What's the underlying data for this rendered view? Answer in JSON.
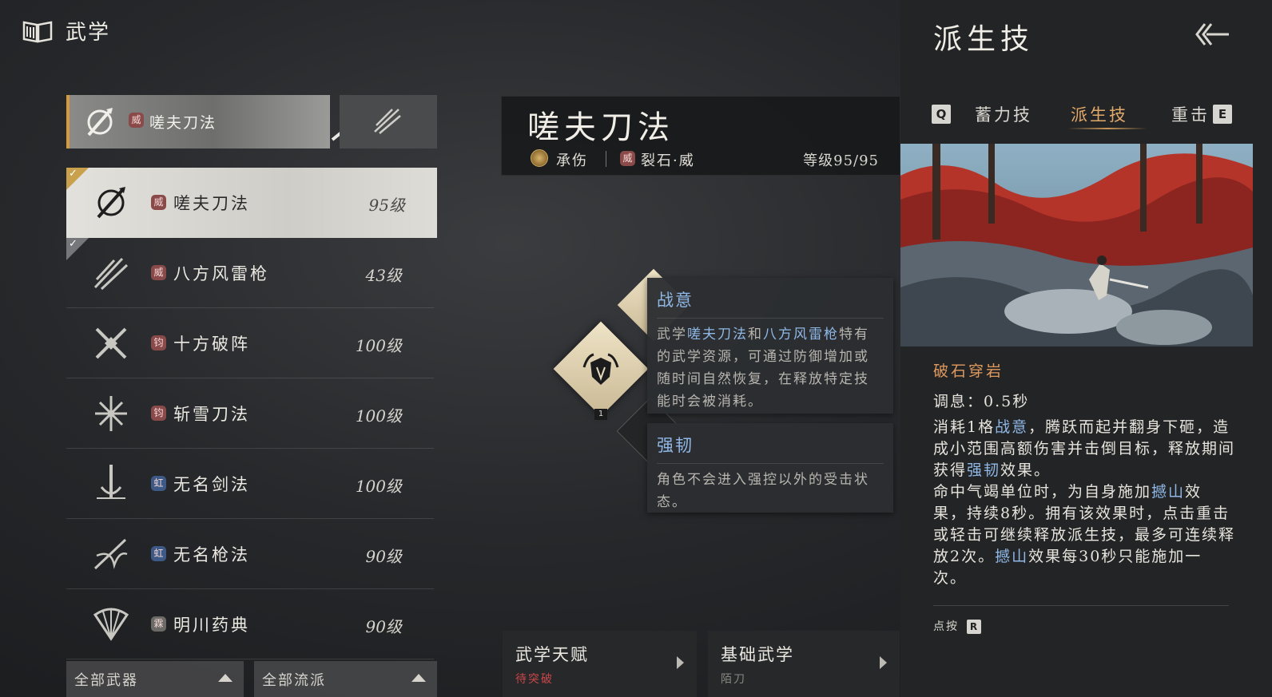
{
  "header": {
    "title": "武学",
    "icon": "book-icon"
  },
  "active_weapon": {
    "seal": "威",
    "name": "嗟夫刀法"
  },
  "weapon_list": [
    {
      "name": "嗟夫刀法",
      "level": "95级",
      "seal": "威",
      "seal_color": "#8b4a4a",
      "selected": true,
      "checked": true
    },
    {
      "name": "八方风雷枪",
      "level": "43级",
      "seal": "威",
      "seal_color": "#8b4a4a",
      "selected": false,
      "checked": true
    },
    {
      "name": "十方破阵",
      "level": "100级",
      "seal": "钧",
      "seal_color": "#8b4a4a",
      "selected": false,
      "checked": false
    },
    {
      "name": "斩雪刀法",
      "level": "100级",
      "seal": "钧",
      "seal_color": "#8b4a4a",
      "selected": false,
      "checked": false
    },
    {
      "name": "无名剑法",
      "level": "100级",
      "seal": "虹",
      "seal_color": "#3d5a86",
      "selected": false,
      "checked": false
    },
    {
      "name": "无名枪法",
      "level": "90级",
      "seal": "虹",
      "seal_color": "#3d5a86",
      "selected": false,
      "checked": false
    },
    {
      "name": "明川药典",
      "level": "90级",
      "seal": "霖",
      "seal_color": "#6c6a66",
      "selected": false,
      "checked": false
    }
  ],
  "filters": [
    {
      "label": "全部武器"
    },
    {
      "label": "全部流派"
    }
  ],
  "skill": {
    "title": "嗟夫刀法",
    "role": "承伤",
    "style_seal": "威",
    "style": "裂石·威",
    "level": "等级95/95"
  },
  "node": {
    "badge": "1"
  },
  "tooltips": {
    "zhanyi": {
      "title": "战意",
      "body_parts": [
        "武学",
        "嗟夫刀法",
        "和",
        "八方风雷枪",
        "特有的武学资源，可通过防御增加或随时间自然恢复，在释放特定技能时会被消耗。"
      ]
    },
    "qiangren": {
      "title": "强韧",
      "body": "角色不会进入强控以外的受击状态。"
    }
  },
  "bottom_cards": [
    {
      "title": "武学天赋",
      "sub": "待突破",
      "sub_color": "#c9474a"
    },
    {
      "title": "基础武学",
      "sub": "陌刀",
      "sub_color": "#8a8782"
    }
  ],
  "right_panel": {
    "title": "派生技",
    "tabs": [
      {
        "key": "Q",
        "label": "蓄力技",
        "active": false
      },
      {
        "label": "派生技",
        "active": true
      },
      {
        "label": "重击",
        "key": "E",
        "active": false
      }
    ],
    "move_name": "破石穿岩",
    "cooldown": "调息：0.5秒",
    "description_parts": [
      {
        "text": "消耗1格",
        "hl": false
      },
      {
        "text": "战意",
        "hl": true
      },
      {
        "text": "，腾跃而起并翻身下砸，造成小范围高额伤害并击倒目标，释放期间获得",
        "hl": false
      },
      {
        "text": "强韧",
        "hl": true
      },
      {
        "text": "效果。",
        "hl": false
      },
      {
        "text": "\n命中气竭单位时，为自身施加",
        "hl": false
      },
      {
        "text": "撼山",
        "hl": true
      },
      {
        "text": "效果，持续8秒。拥有该效果时，点击重击或轻击可继续释放派生技，最多可连续释放2次。",
        "hl": false
      },
      {
        "text": "撼山",
        "hl": true
      },
      {
        "text": "效果每30秒只能施加一次。",
        "hl": false
      }
    ],
    "press_label": "点按",
    "press_key": "R"
  }
}
